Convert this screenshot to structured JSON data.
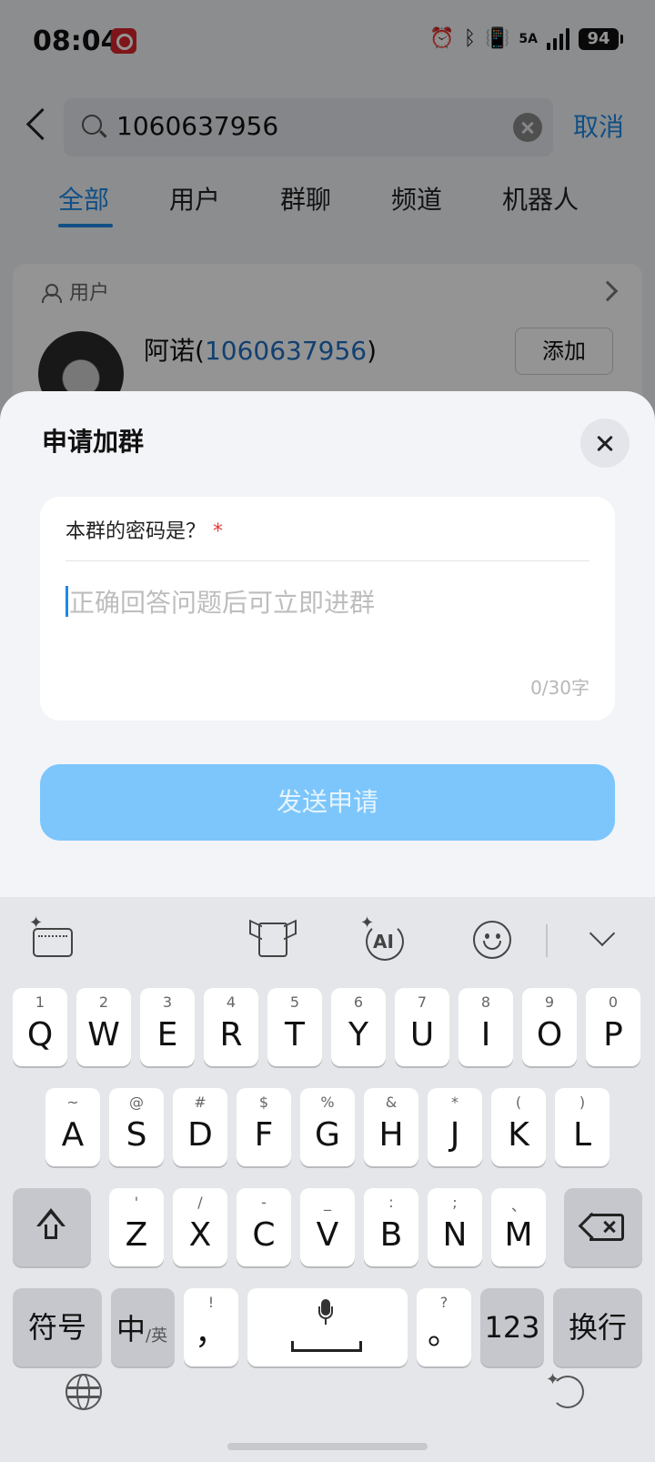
{
  "status_bar": {
    "time": "08:04",
    "network": "5A",
    "battery": "94"
  },
  "search": {
    "value": "1060637956",
    "cancel_label": "取消"
  },
  "tabs": [
    {
      "label": "全部",
      "active": true
    },
    {
      "label": "用户",
      "active": false
    },
    {
      "label": "群聊",
      "active": false
    },
    {
      "label": "频道",
      "active": false
    },
    {
      "label": "机器人",
      "active": false
    }
  ],
  "result": {
    "section_label": "用户",
    "user_name": "阿诺(",
    "user_id": "1060637956",
    "user_name_close": ")",
    "add_label": "添加"
  },
  "sheet": {
    "title": "申请加群",
    "question": "本群的密码是？",
    "required_mark": "*",
    "answer_placeholder": "正确回答问题后可立即进群",
    "answer_value": "",
    "char_count": "0/30字",
    "send_label": "发送申请"
  },
  "keyboard": {
    "row1": [
      {
        "letter": "Q",
        "hint": "1"
      },
      {
        "letter": "W",
        "hint": "2"
      },
      {
        "letter": "E",
        "hint": "3"
      },
      {
        "letter": "R",
        "hint": "4"
      },
      {
        "letter": "T",
        "hint": "5"
      },
      {
        "letter": "Y",
        "hint": "6"
      },
      {
        "letter": "U",
        "hint": "7"
      },
      {
        "letter": "I",
        "hint": "8"
      },
      {
        "letter": "O",
        "hint": "9"
      },
      {
        "letter": "P",
        "hint": "0"
      }
    ],
    "row2": [
      {
        "letter": "A",
        "hint": "~"
      },
      {
        "letter": "S",
        "hint": "@"
      },
      {
        "letter": "D",
        "hint": "#"
      },
      {
        "letter": "F",
        "hint": "$"
      },
      {
        "letter": "G",
        "hint": "%"
      },
      {
        "letter": "H",
        "hint": "&"
      },
      {
        "letter": "J",
        "hint": "*"
      },
      {
        "letter": "K",
        "hint": "("
      },
      {
        "letter": "L",
        "hint": ")"
      }
    ],
    "row3": [
      {
        "letter": "Z",
        "hint": "'"
      },
      {
        "letter": "X",
        "hint": "/"
      },
      {
        "letter": "C",
        "hint": "-"
      },
      {
        "letter": "V",
        "hint": "_"
      },
      {
        "letter": "B",
        "hint": ":"
      },
      {
        "letter": "N",
        "hint": ";"
      },
      {
        "letter": "M",
        "hint": "、"
      }
    ],
    "symbols_label": "符号",
    "lang_main": "中",
    "lang_sub": "/英",
    "comma_key": {
      "letter": "，",
      "hint": "!"
    },
    "period_key": {
      "letter": "。",
      "hint": "?"
    },
    "num_label": "123",
    "enter_label": "换行"
  }
}
